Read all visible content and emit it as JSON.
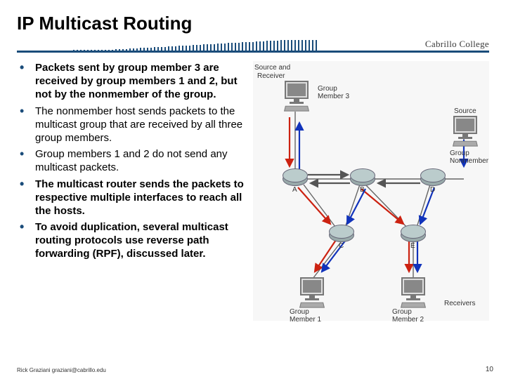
{
  "title": "IP Multicast Routing",
  "college": "Cabrillo College",
  "bullets": [
    {
      "text": "Packets sent by group member 3 are received by group members 1 and 2, but not by the nonmember of the group.",
      "bold": true
    },
    {
      "text": "The nonmember host sends packets to the multicast group that are received by all three group members.",
      "bold": false
    },
    {
      "text": "Group members 1 and 2 do not send any multicast packets.",
      "bold": false
    },
    {
      "text": "The multicast router sends the packets to respective multiple interfaces to reach all the hosts.",
      "bold": true
    },
    {
      "text": "To avoid duplication, several multicast routing protocols use reverse path forwarding (RPF), discussed later.",
      "bold": true
    }
  ],
  "diagram": {
    "hosts": {
      "gm3": {
        "top": "Source and",
        "bottom": "Receiver",
        "label": "Group\nMember 3"
      },
      "nonmember": {
        "top": "Source",
        "label": "Group\nNonmember"
      },
      "gm1": {
        "label": "Group\nMember 1"
      },
      "gm2": {
        "label": "Group\nMember 2"
      },
      "receivers_label": "Receivers"
    },
    "routers": {
      "A": "A",
      "B": "B",
      "C": "C",
      "D": "D",
      "E": "E"
    }
  },
  "footer": "Rick Graziani  graziani@cabrillo.edu",
  "page_number": "10"
}
